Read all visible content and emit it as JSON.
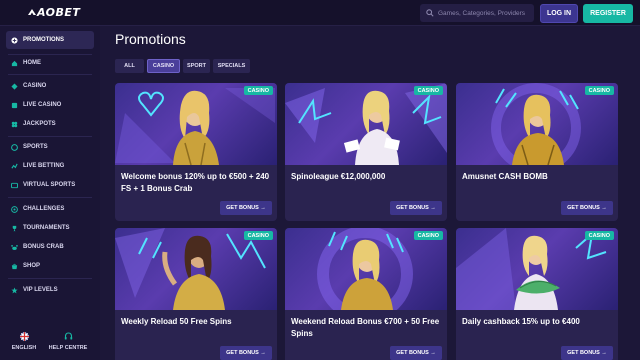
{
  "header": {
    "logo": "AOBET",
    "search_placeholder": "Games, Categories, Providers",
    "login_label": "LOG IN",
    "register_label": "REGISTER"
  },
  "sidebar": {
    "promotions": "PROMOTIONS",
    "home": "HOME",
    "casino": "CASINO",
    "live_casino": "LIVE CASINO",
    "jackpots": "JACKPOTS",
    "sports": "SPORTS",
    "live_betting": "LIVE BETTING",
    "virtual_sports": "VIRTUAL SPORTS",
    "challenges": "CHALLENGES",
    "tournaments": "TOURNAMENTS",
    "bonus_crab": "BONUS CRAB",
    "shop": "SHOP",
    "vip_levels": "VIP LEVELS",
    "language": "ENGLISH",
    "help": "HELP CENTRE"
  },
  "main": {
    "title": "Promotions",
    "tabs": [
      "ALL",
      "CASINO",
      "SPORT",
      "SPECIALS"
    ],
    "active_tab": "CASINO"
  },
  "cards": [
    {
      "badge": "CASINO",
      "title": "Welcome bonus 120% up to €500 + 240 FS + 1 Bonus Crab",
      "cta": "GET BONUS →"
    },
    {
      "badge": "CASINO",
      "title": "Spinoleague €12,000,000",
      "cta": "GET BONUS →"
    },
    {
      "badge": "CASINO",
      "title": "Amusnet CASH BOMB",
      "cta": "GET BONUS →"
    },
    {
      "badge": "CASINO",
      "title": "Weekly Reload 50 Free Spins",
      "cta": "GET BONUS →"
    },
    {
      "badge": "CASINO",
      "title": "Weekend Reload Bonus €700 + 50 Free Spins",
      "cta": "GET BONUS →"
    },
    {
      "badge": "CASINO",
      "title": "Daily cashback 15% up to €400",
      "cta": "GET BONUS →"
    }
  ],
  "colors": {
    "background": "#1c1738",
    "sidebar": "#1a1535",
    "card": "#2a2350",
    "accent_teal": "#17b8a4",
    "login_button": "#3c3590"
  }
}
